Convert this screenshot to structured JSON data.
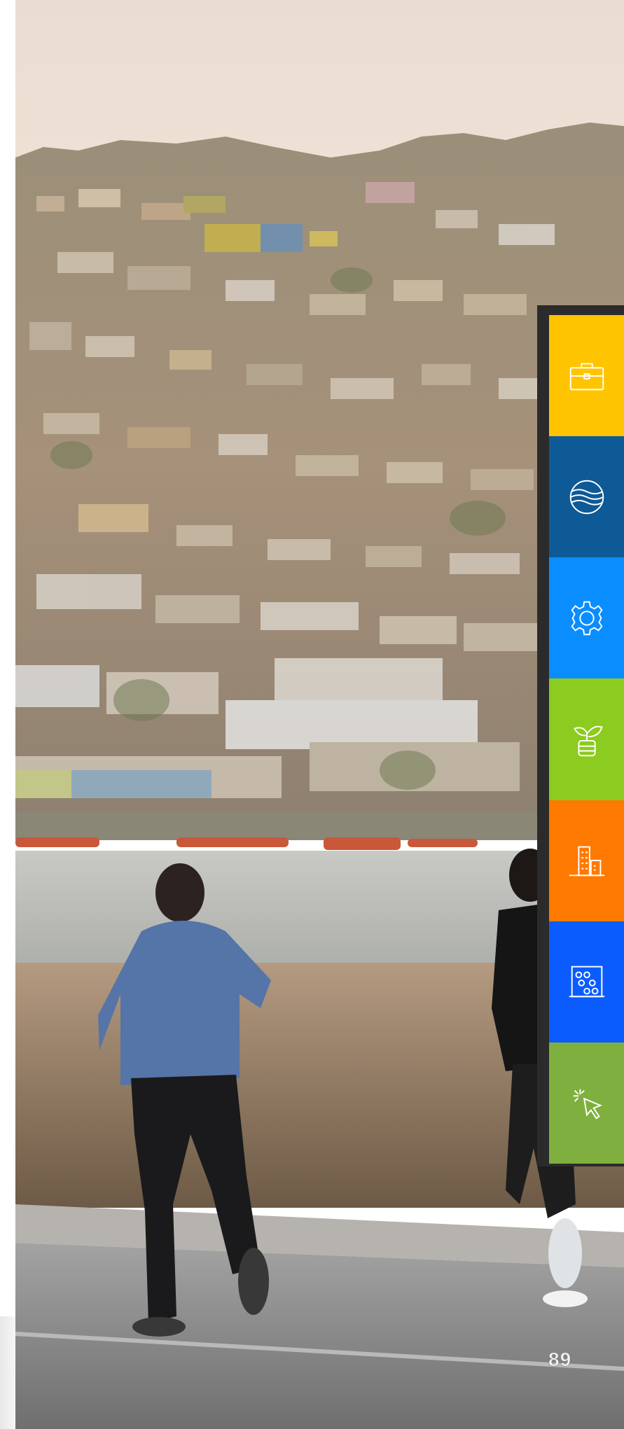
{
  "page": {
    "number": "89"
  },
  "photo": {
    "scene": "hillside-town-waterfront-joggers"
  },
  "nav": {
    "items": [
      {
        "id": "employment",
        "icon": "briefcase-icon",
        "color": "#FFC400"
      },
      {
        "id": "water",
        "icon": "globe-waves-icon",
        "color": "#0E5A96"
      },
      {
        "id": "industry",
        "icon": "gear-icon",
        "color": "#0A8DFF"
      },
      {
        "id": "agriculture",
        "icon": "sprout-icon",
        "color": "#8CCB1F"
      },
      {
        "id": "urban",
        "icon": "buildings-icon",
        "color": "#FF7A00"
      },
      {
        "id": "education",
        "icon": "abacus-icon",
        "color": "#0B5CFF"
      },
      {
        "id": "digital",
        "icon": "click-cursor-icon",
        "color": "#7FAF3E"
      }
    ]
  }
}
